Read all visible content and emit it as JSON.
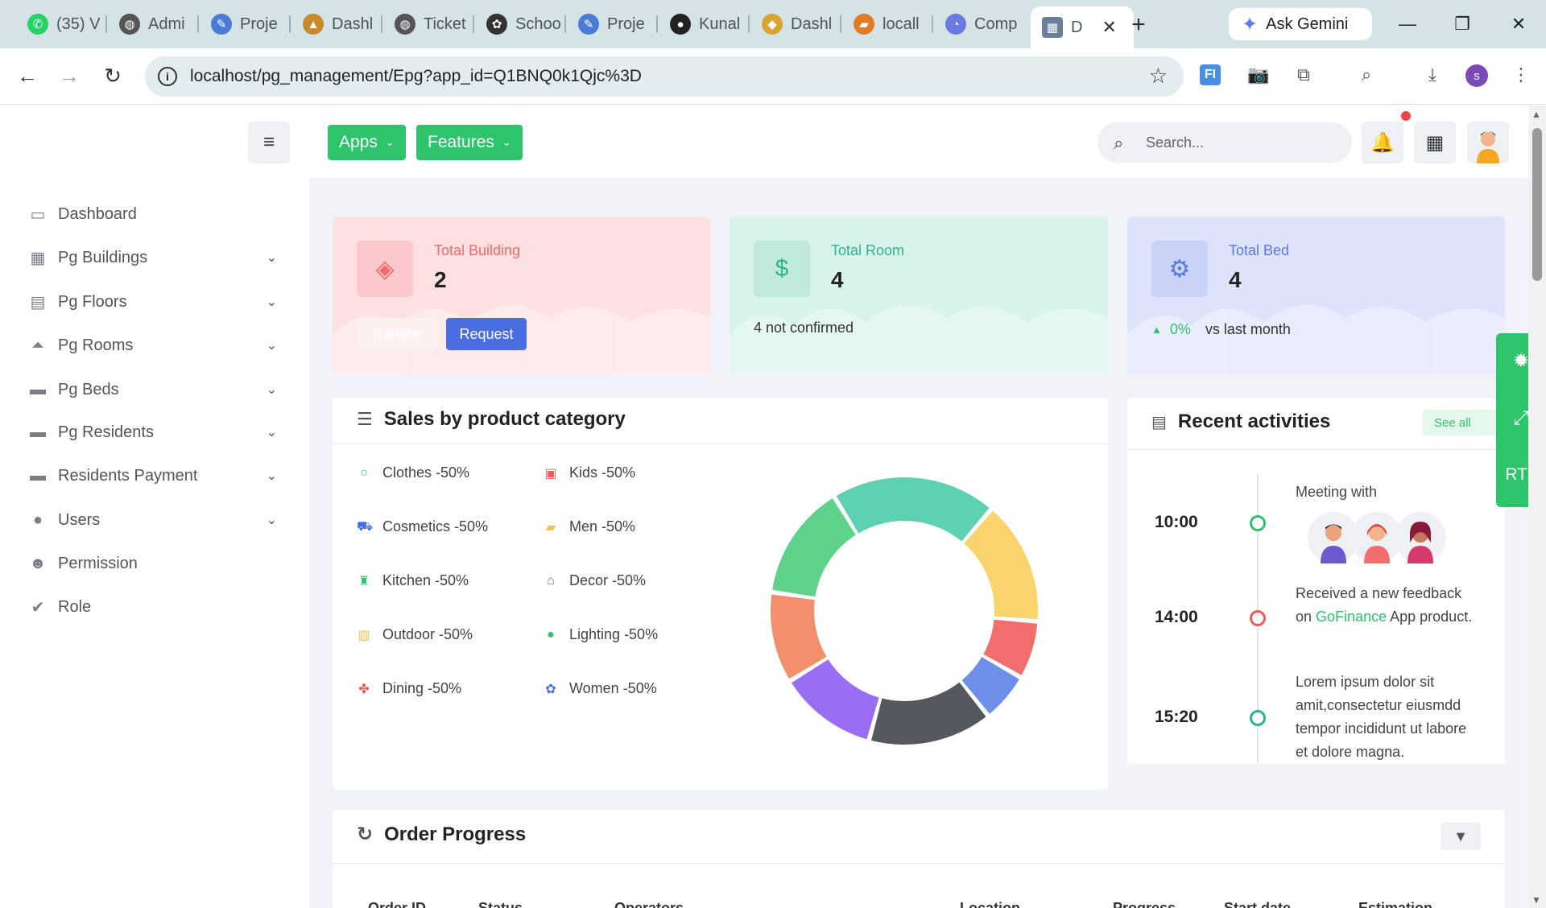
{
  "browser": {
    "tabs": [
      {
        "label": "(35) V",
        "icon": "whatsapp-icon",
        "color": "#25d366"
      },
      {
        "label": "Admi",
        "icon": "globe-icon",
        "color": "#555555"
      },
      {
        "label": "Proje",
        "icon": "project-icon",
        "color": "#4a7bd6"
      },
      {
        "label": "Dashl",
        "icon": "dashboard-icon",
        "color": "#c98a2b"
      },
      {
        "label": "Ticket",
        "icon": "globe-icon",
        "color": "#555555"
      },
      {
        "label": "Schoo",
        "icon": "openai-icon",
        "color": "#333333"
      },
      {
        "label": "Proje",
        "icon": "project-icon",
        "color": "#4a7bd6"
      },
      {
        "label": "Kunal",
        "icon": "github-icon",
        "color": "#222222"
      },
      {
        "label": "Dashl",
        "icon": "package-icon",
        "color": "#d9a330"
      },
      {
        "label": "locall",
        "icon": "phpmyadmin-icon",
        "color": "#e07c24"
      },
      {
        "label": "Comp",
        "icon": "chart-icon",
        "color": "#6a7be0"
      }
    ],
    "active_tab": {
      "label": "D"
    },
    "gemini_label": "Ask Gemini",
    "url": "localhost/pg_management/Epg?app_id=Q1BNQ0k1Qjc%3D",
    "profile_initial": "s"
  },
  "topbar": {
    "apps_label": "Apps",
    "features_label": "Features",
    "search_placeholder": "Search..."
  },
  "sidebar": {
    "items": [
      {
        "label": "Dashboard",
        "icon": "monitor-icon",
        "has_children": false
      },
      {
        "label": "Pg Buildings",
        "icon": "building-icon",
        "has_children": true
      },
      {
        "label": "Pg Floors",
        "icon": "floor-icon",
        "has_children": true
      },
      {
        "label": "Pg Rooms",
        "icon": "room-icon",
        "has_children": true
      },
      {
        "label": "Pg Beds",
        "icon": "bed-icon",
        "has_children": true
      },
      {
        "label": "Pg Residents",
        "icon": "bed-icon",
        "has_children": true
      },
      {
        "label": "Residents Payment",
        "icon": "bed-icon",
        "has_children": true
      },
      {
        "label": "Users",
        "icon": "user-icon",
        "has_children": true
      },
      {
        "label": "Permission",
        "icon": "users-icon",
        "has_children": false
      },
      {
        "label": "Role",
        "icon": "user-check-icon",
        "has_children": false
      }
    ]
  },
  "stats": {
    "building": {
      "label": "Total Building",
      "value": "2",
      "transfer_label": "Transfer",
      "request_label": "Request",
      "color": "#f06a6a"
    },
    "room": {
      "label": "Total Room",
      "value": "4",
      "note": "4 not confirmed",
      "color": "#2bb58d"
    },
    "bed": {
      "label": "Total Bed",
      "value": "4",
      "change": "0%",
      "change_suffix": "vs last month",
      "color": "#5a78e0"
    }
  },
  "sales": {
    "title": "Sales by product category",
    "legend": [
      {
        "label": "Clothes -50%",
        "icon": "circle-icon",
        "color": "#2ec46b"
      },
      {
        "label": "Kids -50%",
        "icon": "kids-icon",
        "color": "#f05a5a"
      },
      {
        "label": "Cosmetics -50%",
        "icon": "cart-icon",
        "color": "#4a6de0"
      },
      {
        "label": "Men -50%",
        "icon": "men-icon",
        "color": "#f5c14a"
      },
      {
        "label": "Kitchen -50%",
        "icon": "kitchen-icon",
        "color": "#2ec46b"
      },
      {
        "label": "Decor -50%",
        "icon": "decor-icon",
        "color": "#4a6de0"
      },
      {
        "label": "Outdoor -50%",
        "icon": "outdoor-icon",
        "color": "#f5c14a"
      },
      {
        "label": "Lighting -50%",
        "icon": "lighting-icon",
        "color": "#2ec46b"
      },
      {
        "label": "Dining -50%",
        "icon": "dining-icon",
        "color": "#f05a5a"
      },
      {
        "label": "Women -50%",
        "icon": "women-icon",
        "color": "#4a6de0"
      }
    ]
  },
  "chart_data": {
    "type": "pie",
    "donut": true,
    "categories": [
      "Teal",
      "Yellow",
      "Red",
      "Blue",
      "Dark",
      "Purple",
      "Salmon",
      "Green"
    ],
    "values": [
      20,
      15,
      7,
      6,
      15,
      12,
      11,
      14
    ],
    "colors": [
      "#5fd1b3",
      "#fbd36d",
      "#f26d6d",
      "#6e8fe9",
      "#55595f",
      "#9a6ef2",
      "#f2906e",
      "#5ed18a"
    ]
  },
  "activities": {
    "title": "Recent activities",
    "see_all": "See all",
    "items": [
      {
        "time": "10:00",
        "text": "Meeting with",
        "color": "#2ec46b"
      },
      {
        "time": "14:00",
        "text_pre": "Received a new feedback on",
        "link": "GoFinance",
        "text_post": "App product.",
        "color": "#f05a5a"
      },
      {
        "time": "15:20",
        "text": "Lorem ipsum dolor sit amit,consectetur eiusmdd tempor incididunt ut labore et dolore magna.",
        "color": "#2bb58d"
      }
    ]
  },
  "orders": {
    "title": "Order Progress",
    "columns": [
      "Order ID",
      "Status",
      "Operators",
      "Location",
      "Progress",
      "Start date",
      "Estimation"
    ]
  },
  "floating": {
    "rtl_label": "RTL"
  }
}
